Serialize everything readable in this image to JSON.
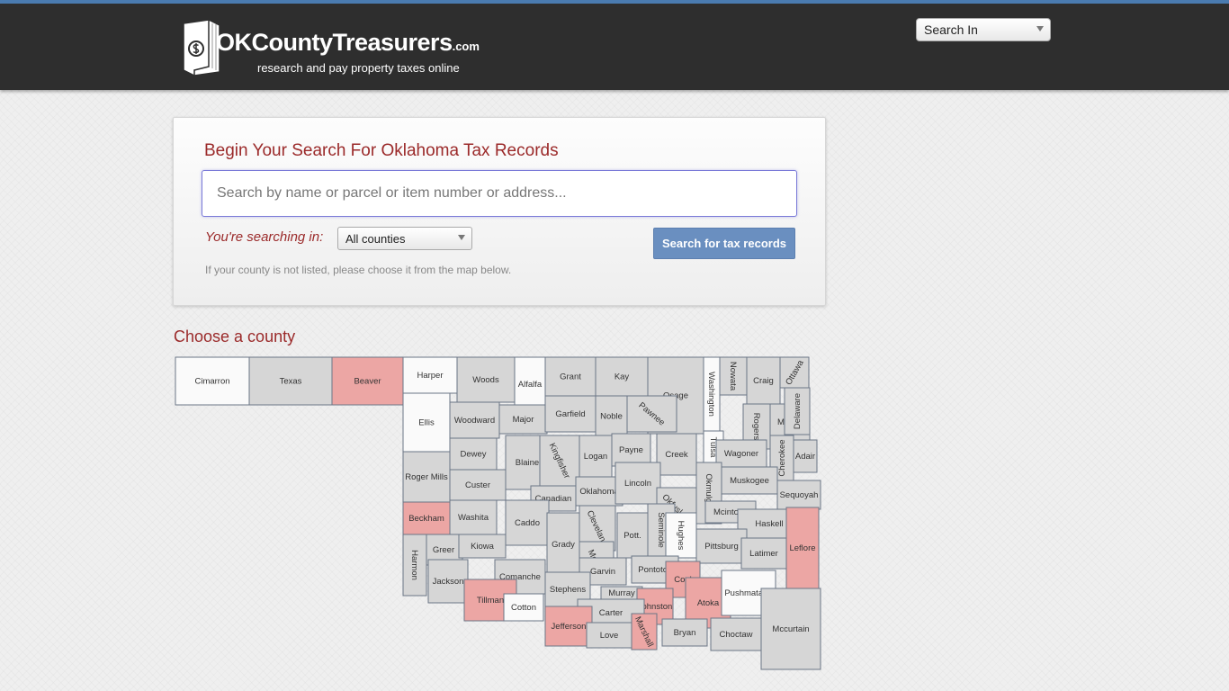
{
  "header": {
    "logo_name": "OKCountyTreasurers",
    "logo_tld": ".com",
    "tagline": "research and pay property taxes online",
    "search_in_label": "Search In"
  },
  "search": {
    "title": "Begin Your Search For Oklahoma Tax Records",
    "placeholder": "Search by name or parcel or item number or address...",
    "searching_in_label": "You're searching in:",
    "county_selected": "All counties",
    "button_label": "Search for tax records",
    "hint": "If your county is not listed, please choose it from the map below."
  },
  "map": {
    "title": "Choose a county",
    "colors": {
      "active": "#d6d6d6",
      "highlight": "#eca6a4",
      "unlisted": "#fafafa",
      "border": "#6b7686"
    },
    "counties": [
      {
        "name": "Cimarron",
        "status": "unlisted"
      },
      {
        "name": "Texas",
        "status": "active"
      },
      {
        "name": "Beaver",
        "status": "highlight"
      },
      {
        "name": "Harper",
        "status": "unlisted"
      },
      {
        "name": "Woods",
        "status": "active"
      },
      {
        "name": "Alfalfa",
        "status": "unlisted"
      },
      {
        "name": "Grant",
        "status": "active"
      },
      {
        "name": "Kay",
        "status": "active"
      },
      {
        "name": "Osage",
        "status": "active"
      },
      {
        "name": "Washington",
        "status": "unlisted"
      },
      {
        "name": "Nowata",
        "status": "active"
      },
      {
        "name": "Craig",
        "status": "active"
      },
      {
        "name": "Ottawa",
        "status": "active"
      },
      {
        "name": "Ellis",
        "status": "unlisted"
      },
      {
        "name": "Woodward",
        "status": "active"
      },
      {
        "name": "Major",
        "status": "active"
      },
      {
        "name": "Garfield",
        "status": "active"
      },
      {
        "name": "Noble",
        "status": "active"
      },
      {
        "name": "Pawnee",
        "status": "active"
      },
      {
        "name": "Tulsa",
        "status": "unlisted"
      },
      {
        "name": "Rogers",
        "status": "active"
      },
      {
        "name": "Mayes",
        "status": "active"
      },
      {
        "name": "Delaware",
        "status": "active"
      },
      {
        "name": "Dewey",
        "status": "active"
      },
      {
        "name": "Blaine",
        "status": "active"
      },
      {
        "name": "Kingfisher",
        "status": "active"
      },
      {
        "name": "Logan",
        "status": "active"
      },
      {
        "name": "Payne",
        "status": "active"
      },
      {
        "name": "Creek",
        "status": "active"
      },
      {
        "name": "Wagoner",
        "status": "active"
      },
      {
        "name": "Cherokee",
        "status": "active"
      },
      {
        "name": "Adair",
        "status": "active"
      },
      {
        "name": "Roger Mills",
        "status": "active"
      },
      {
        "name": "Custer",
        "status": "active"
      },
      {
        "name": "Canadian",
        "status": "active"
      },
      {
        "name": "Oklahoma",
        "status": "active"
      },
      {
        "name": "Lincoln",
        "status": "active"
      },
      {
        "name": "Okmulgee",
        "status": "active"
      },
      {
        "name": "Muskogee",
        "status": "active"
      },
      {
        "name": "Sequoyah",
        "status": "active"
      },
      {
        "name": "Beckham",
        "status": "highlight"
      },
      {
        "name": "Washita",
        "status": "active"
      },
      {
        "name": "Caddo",
        "status": "active"
      },
      {
        "name": "Cleveland",
        "status": "active"
      },
      {
        "name": "Okfuskee",
        "status": "active"
      },
      {
        "name": "Mcintosh",
        "status": "active"
      },
      {
        "name": "Haskell",
        "status": "active"
      },
      {
        "name": "Greer",
        "status": "active"
      },
      {
        "name": "Kiowa",
        "status": "active"
      },
      {
        "name": "Grady",
        "status": "active"
      },
      {
        "name": "Mcclain",
        "status": "active"
      },
      {
        "name": "Pott.",
        "status": "active"
      },
      {
        "name": "Seminole",
        "status": "active"
      },
      {
        "name": "Hughes",
        "status": "unlisted"
      },
      {
        "name": "Pittsburg",
        "status": "active"
      },
      {
        "name": "Latimer",
        "status": "active"
      },
      {
        "name": "Leflore",
        "status": "highlight"
      },
      {
        "name": "Harmon",
        "status": "active"
      },
      {
        "name": "Jackson",
        "status": "active"
      },
      {
        "name": "Comanche",
        "status": "active"
      },
      {
        "name": "Garvin",
        "status": "active"
      },
      {
        "name": "Pontotoc",
        "status": "active"
      },
      {
        "name": "Coal",
        "status": "highlight"
      },
      {
        "name": "Tillman",
        "status": "highlight"
      },
      {
        "name": "Cotton",
        "status": "unlisted"
      },
      {
        "name": "Stephens",
        "status": "active"
      },
      {
        "name": "Murray",
        "status": "active"
      },
      {
        "name": "Johnston",
        "status": "highlight"
      },
      {
        "name": "Atoka",
        "status": "highlight"
      },
      {
        "name": "Pushmataha",
        "status": "unlisted"
      },
      {
        "name": "Carter",
        "status": "active"
      },
      {
        "name": "Jefferson",
        "status": "highlight"
      },
      {
        "name": "Love",
        "status": "active"
      },
      {
        "name": "Marshall",
        "status": "highlight"
      },
      {
        "name": "Bryan",
        "status": "active"
      },
      {
        "name": "Choctaw",
        "status": "active"
      },
      {
        "name": "Mccurtain",
        "status": "active"
      }
    ]
  }
}
